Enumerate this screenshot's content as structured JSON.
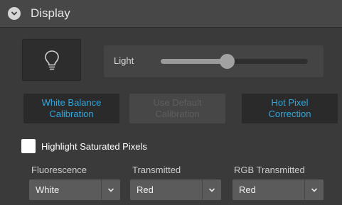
{
  "header": {
    "title": "Display",
    "collapse_icon": "chevron-down-icon"
  },
  "light": {
    "icon": "lightbulb-icon",
    "label": "Light",
    "slider_value": 0.45
  },
  "buttons": {
    "white_balance": "White Balance\nCalibration",
    "use_default": "Use Default\nCalibration",
    "hot_pixel": "Hot Pixel\nCorrection"
  },
  "highlight": {
    "label": "Highlight Saturated Pixels",
    "checked": false
  },
  "channels": [
    {
      "label": "Fluorescence",
      "value": "White"
    },
    {
      "label": "Transmitted",
      "value": "Red"
    },
    {
      "label": "RGB Transmitted",
      "value": "Red"
    }
  ],
  "colors": {
    "accent": "#2fa6dc",
    "panel": "#3a3a3a",
    "header": "#474747"
  }
}
